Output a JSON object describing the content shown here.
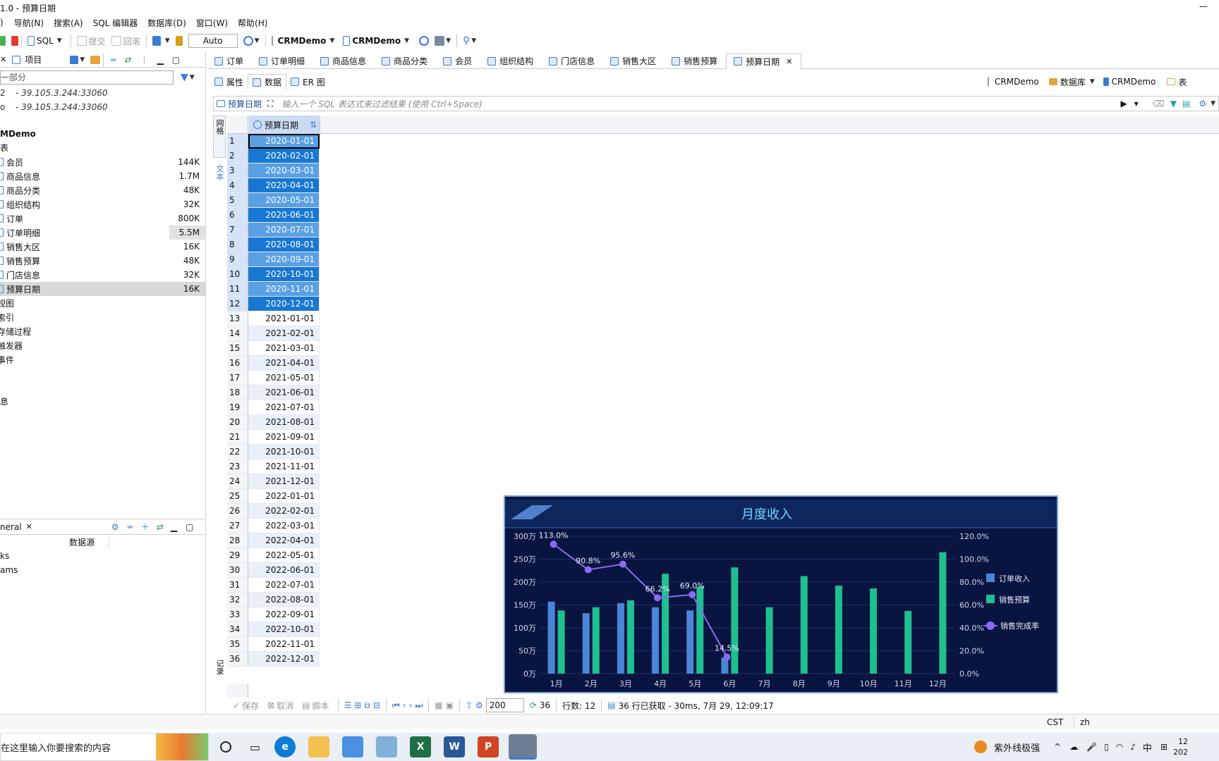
{
  "window": {
    "title": "1.0 - 预算日期"
  },
  "menu": [
    "导航(N)",
    "搜索(A)",
    "SQL 编辑器",
    "数据库(D)",
    "窗口(W)",
    "帮助(H)"
  ],
  "menu_partial": ")",
  "toolbar": {
    "sql_label": "SQL",
    "commit_label": "提交",
    "rollback_label": "回滚",
    "tx_mode": "Auto",
    "conn1": "CRMDemo",
    "conn2": "CRMDemo"
  },
  "project_panel": {
    "title": "项目",
    "filter_placeholder": "一部分",
    "connections": [
      {
        "prefix": "2",
        "host": "- 39.105.3.244:33060"
      },
      {
        "prefix": "o",
        "host": "- 39.105.3.244:33060"
      }
    ],
    "db_name": "MDemo",
    "tables_label": "表",
    "tables": [
      {
        "name": "会员",
        "size": "144K"
      },
      {
        "name": "商品信息",
        "size": "1.7M"
      },
      {
        "name": "商品分类",
        "size": "48K"
      },
      {
        "name": "组织结构",
        "size": "32K"
      },
      {
        "name": "订单",
        "size": "800K"
      },
      {
        "name": "订单明细",
        "size": "5.5M"
      },
      {
        "name": "销售大区",
        "size": "16K"
      },
      {
        "name": "销售预算",
        "size": "48K"
      },
      {
        "name": "门店信息",
        "size": "32K"
      },
      {
        "name": "预算日期",
        "size": "16K"
      }
    ],
    "other_nodes": [
      "视图",
      "索引",
      "存储过程",
      "触发器",
      "事件"
    ],
    "info_node": "息"
  },
  "general_panel": {
    "title": "neral",
    "col_header": "数据源",
    "items": [
      "ks",
      "ams"
    ]
  },
  "editor_tabs": [
    "订单",
    "订单明细",
    "商品信息",
    "商品分类",
    "会员",
    "组织结构",
    "门店信息",
    "销售大区",
    "销售预算",
    "预算日期"
  ],
  "sub_tabs": [
    "属性",
    "数据",
    "ER 图"
  ],
  "right_crumbs": [
    "CRMDemo",
    "数据库",
    "CRMDemo",
    "表"
  ],
  "filter_bar": {
    "table_label": "预算日期",
    "placeholder": "输入一个 SQL 表达式来过滤结果 (使用 Ctrl+Space)"
  },
  "side_tabs": {
    "grid": "网格",
    "text": "文本",
    "record": "记录"
  },
  "grid": {
    "column": "预算日期",
    "rows": [
      "2020-01-01",
      "2020-02-01",
      "2020-03-01",
      "2020-04-01",
      "2020-05-01",
      "2020-06-01",
      "2020-07-01",
      "2020-08-01",
      "2020-09-01",
      "2020-10-01",
      "2020-11-01",
      "2020-12-01",
      "2021-01-01",
      "2021-02-01",
      "2021-03-01",
      "2021-04-01",
      "2021-05-01",
      "2021-06-01",
      "2021-07-01",
      "2021-08-01",
      "2021-09-01",
      "2021-10-01",
      "2021-11-01",
      "2021-12-01",
      "2022-01-01",
      "2022-02-01",
      "2022-03-01",
      "2022-04-01",
      "2022-05-01",
      "2022-06-01",
      "2022-07-01",
      "2022-08-01",
      "2022-09-01",
      "2022-10-01",
      "2022-11-01",
      "2022-12-01"
    ],
    "selected_count": 12
  },
  "bottom_bar": {
    "save": "保存",
    "cancel": "取消",
    "script": "脚本",
    "fetch_size": "200",
    "count": "36",
    "rows_label": "行数: 12",
    "status": "36 行已获取 - 30ms, 7月 29, 12:09:17"
  },
  "status_bar": {
    "tz": "CST",
    "locale": "zh"
  },
  "taskbar": {
    "search_placeholder": "在这里输入你要搜索的内容",
    "weather": "紫外线极强",
    "ime": "中",
    "clock_partial": "12",
    "date_partial": "202"
  },
  "chart_data": {
    "type": "bar",
    "title": "月度收入",
    "categories": [
      "1月",
      "2月",
      "3月",
      "4月",
      "5月",
      "6月",
      "7月",
      "8月",
      "9月",
      "10月",
      "11月",
      "12月"
    ],
    "y_left_ticks": [
      "0万",
      "50万",
      "100万",
      "150万",
      "200万",
      "250万",
      "300万"
    ],
    "y_right_ticks": [
      "0.0%",
      "20.0%",
      "40.0%",
      "60.0%",
      "80.0%",
      "100.0%",
      "120.0%"
    ],
    "ylim_left": [
      0,
      300
    ],
    "ylim_right": [
      0,
      120
    ],
    "legend_position": "right",
    "series": [
      {
        "name": "订单收入",
        "kind": "bar",
        "color": "#4a86d8",
        "values": [
          157,
          132,
          154,
          145,
          138,
          35,
          null,
          null,
          null,
          null,
          null,
          null
        ]
      },
      {
        "name": "销售预算",
        "kind": "bar",
        "color": "#1fbf8f",
        "values": [
          138,
          145,
          160,
          218,
          190,
          232,
          145,
          213,
          192,
          186,
          137,
          265
        ]
      },
      {
        "name": "销售完成率",
        "kind": "line",
        "color": "#8a6cf0",
        "values": [
          113.0,
          90.8,
          95.6,
          66.2,
          69.0,
          14.5,
          null,
          null,
          null,
          null,
          null,
          null
        ],
        "labels": [
          "113.0%",
          "90.8%",
          "95.6%",
          "66.2%",
          "69.0%",
          "14.5%"
        ]
      }
    ]
  }
}
